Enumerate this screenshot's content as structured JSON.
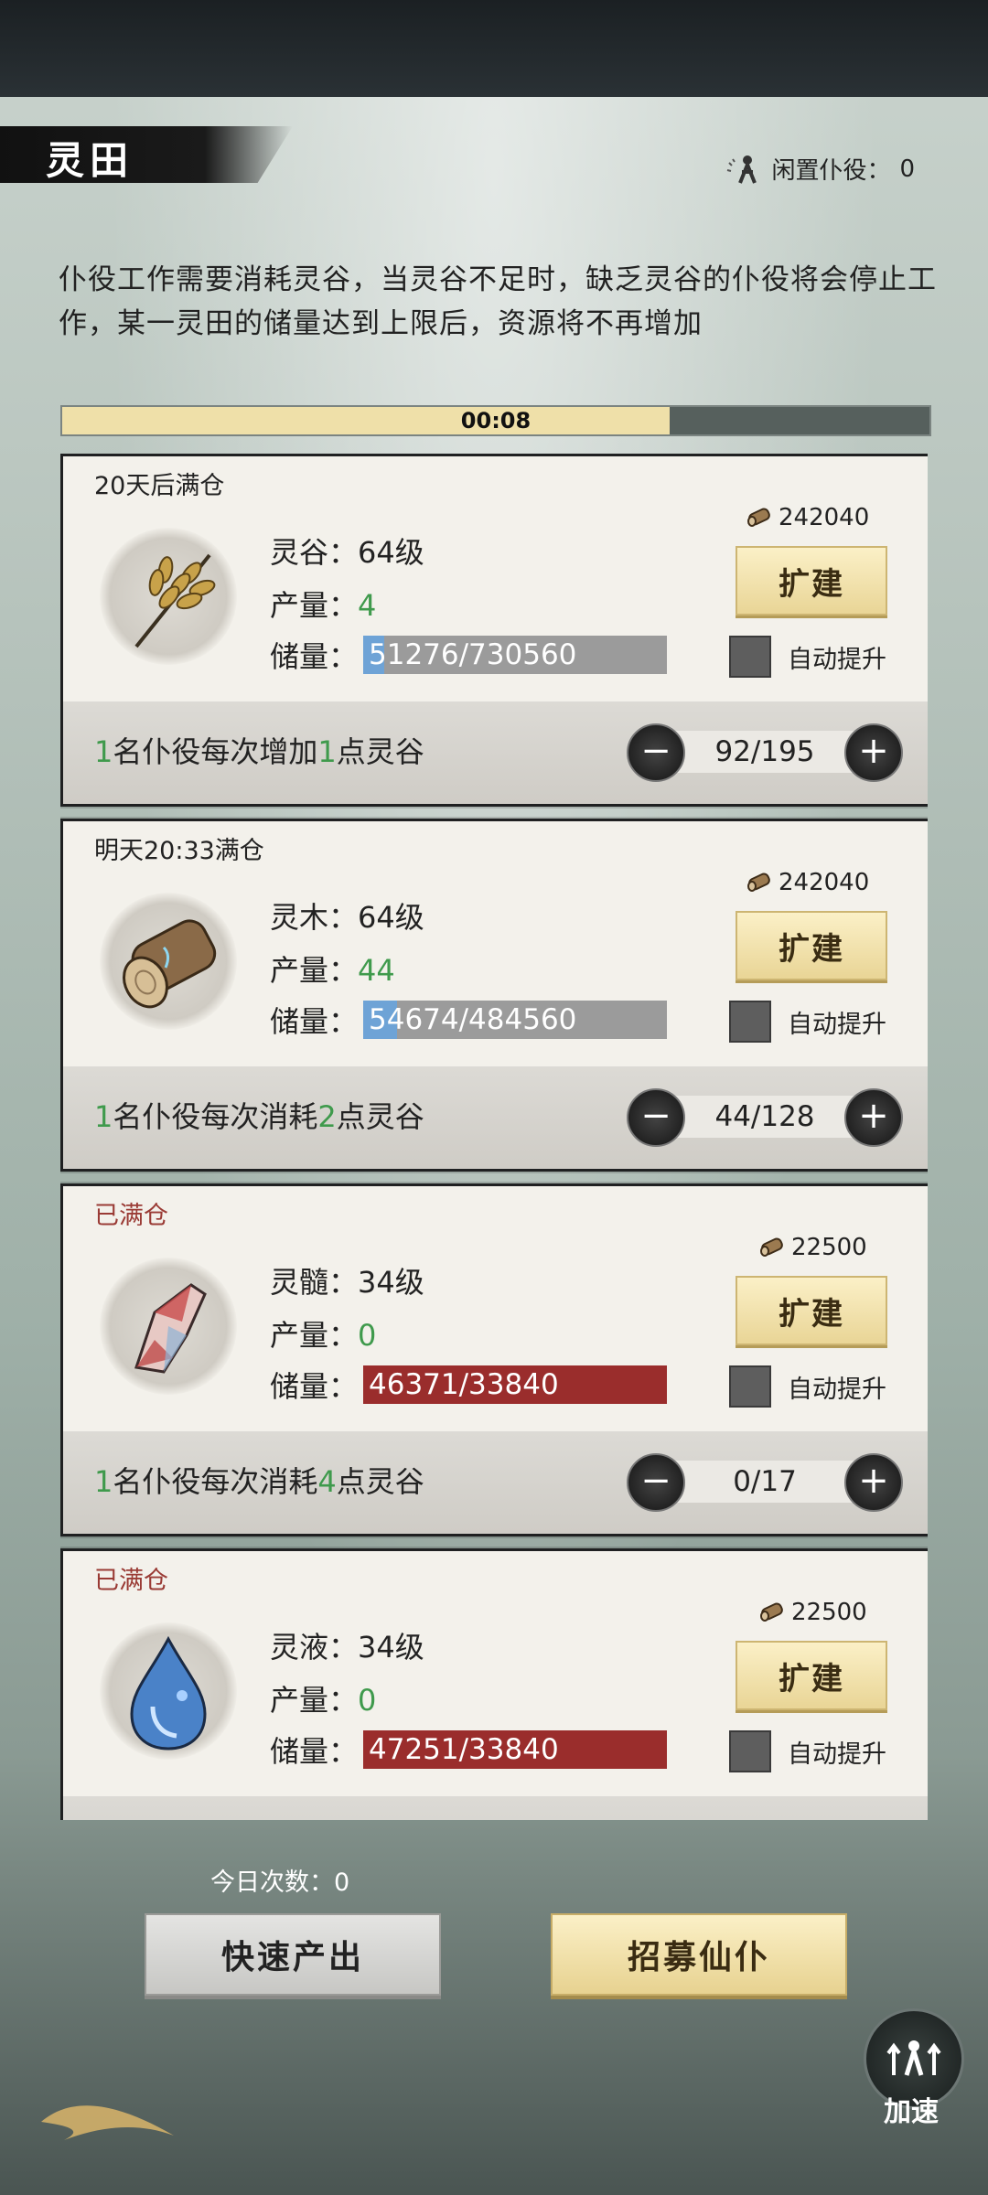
{
  "header": {
    "title": "灵田",
    "idle_label": "闲置仆役：",
    "idle_count": "0"
  },
  "description": "仆役工作需要消耗灵谷，当灵谷不足时，缺乏灵谷的仆役将会停止工作，某一灵田的储量达到上限后，资源将不再增加",
  "timer": {
    "text": "00:08",
    "progress": 0.7
  },
  "cards": [
    {
      "status": "20天后满仓",
      "status_full": false,
      "icon": "wheat-icon",
      "name_line": "灵谷：64级",
      "output_label": "产量：",
      "output": "4",
      "storage_label": "储量：",
      "storage": "51276/730560",
      "storage_current": 51276,
      "storage_max": 730560,
      "cost": "242040",
      "expand": "扩建",
      "auto": "自动提升",
      "foot_a": "1",
      "foot_b": "名仆役每次增加",
      "foot_c": "1",
      "foot_d": "点灵谷",
      "workers": "92/195"
    },
    {
      "status": "明天20:33满仓",
      "status_full": false,
      "icon": "wood-icon",
      "name_line": "灵木：64级",
      "output_label": "产量：",
      "output": "44",
      "storage_label": "储量：",
      "storage": "54674/484560",
      "storage_current": 54674,
      "storage_max": 484560,
      "cost": "242040",
      "expand": "扩建",
      "auto": "自动提升",
      "foot_a": "1",
      "foot_b": "名仆役每次消耗",
      "foot_c": "2",
      "foot_d": "点灵谷",
      "workers": "44/128"
    },
    {
      "status": "已满仓",
      "status_full": true,
      "icon": "crystal-icon",
      "name_line": "灵髓：34级",
      "output_label": "产量：",
      "output": "0",
      "storage_label": "储量：",
      "storage": "46371/33840",
      "storage_current": 46371,
      "storage_max": 33840,
      "cost": "22500",
      "expand": "扩建",
      "auto": "自动提升",
      "foot_a": "1",
      "foot_b": "名仆役每次消耗",
      "foot_c": "4",
      "foot_d": "点灵谷",
      "workers": "0/17"
    },
    {
      "status": "已满仓",
      "status_full": true,
      "icon": "water-drop-icon",
      "name_line": "灵液：34级",
      "output_label": "产量：",
      "output": "0",
      "storage_label": "储量：",
      "storage": "47251/33840",
      "storage_current": 47251,
      "storage_max": 33840,
      "cost": "22500",
      "expand": "扩建",
      "auto": "自动提升"
    }
  ],
  "footer": {
    "today_label": "今日次数：",
    "today_count": "0",
    "quick_output": "快速产出",
    "recruit": "招募仙仆",
    "speed_up": "加速"
  },
  "colors": {
    "green": "#3f9a4c",
    "full_red": "#9a3b35",
    "storage_blue": "#6ea3d6",
    "storage_over": "#9a2d2c",
    "gold": "#e9d596"
  }
}
